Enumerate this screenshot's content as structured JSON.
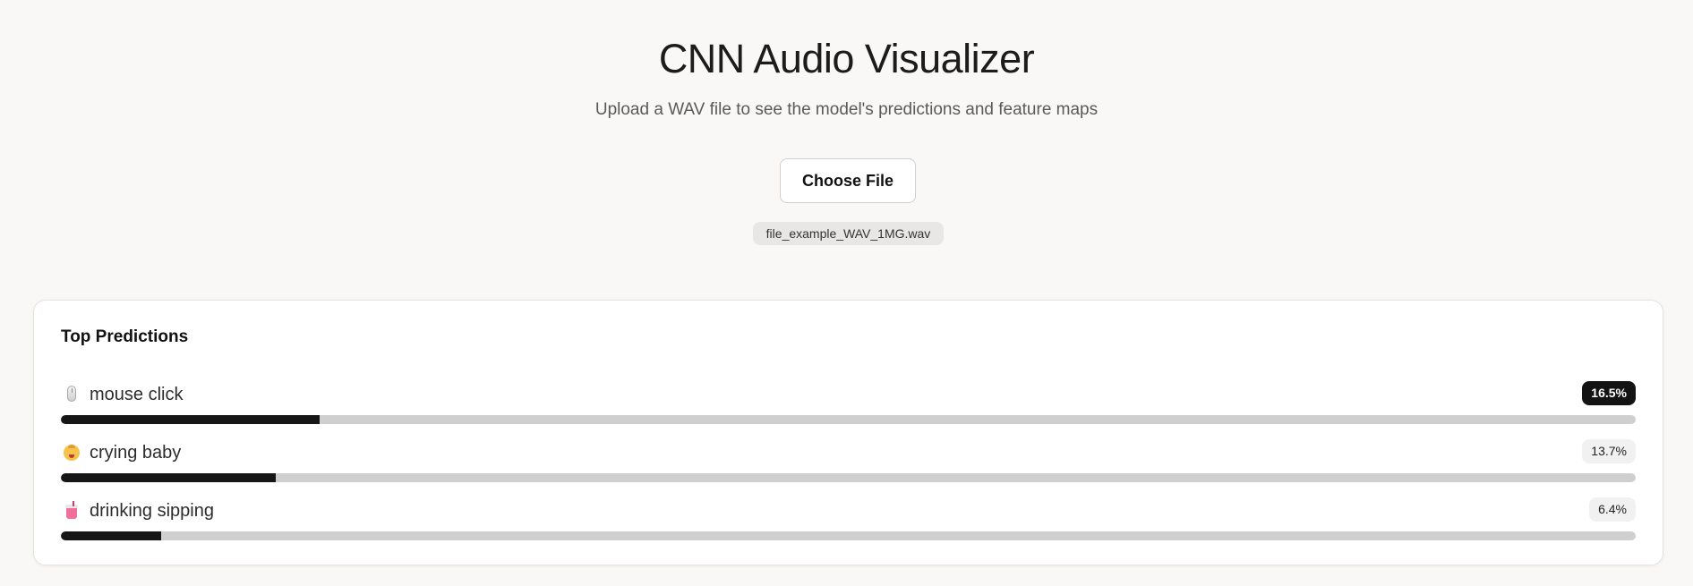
{
  "header": {
    "title": "CNN Audio Visualizer",
    "subtitle": "Upload a WAV file to see the model's predictions and feature maps"
  },
  "upload": {
    "button_label": "Choose File",
    "file_name": "file_example_WAV_1MG.wav"
  },
  "predictions": {
    "title": "Top Predictions",
    "items": [
      {
        "icon": "computer-mouse-icon",
        "label": "mouse click",
        "percent_text": "16.5%",
        "value": 16.5
      },
      {
        "icon": "crying-baby-icon",
        "label": "crying baby",
        "percent_text": "13.7%",
        "value": 13.7
      },
      {
        "icon": "cup-with-straw-icon",
        "label": "drinking sipping",
        "percent_text": "6.4%",
        "value": 6.4
      }
    ]
  },
  "colors": {
    "background": "#f9f8f6",
    "bar_fill": "#161616",
    "bar_track": "#cfcfcf",
    "top_badge": "#131313"
  }
}
